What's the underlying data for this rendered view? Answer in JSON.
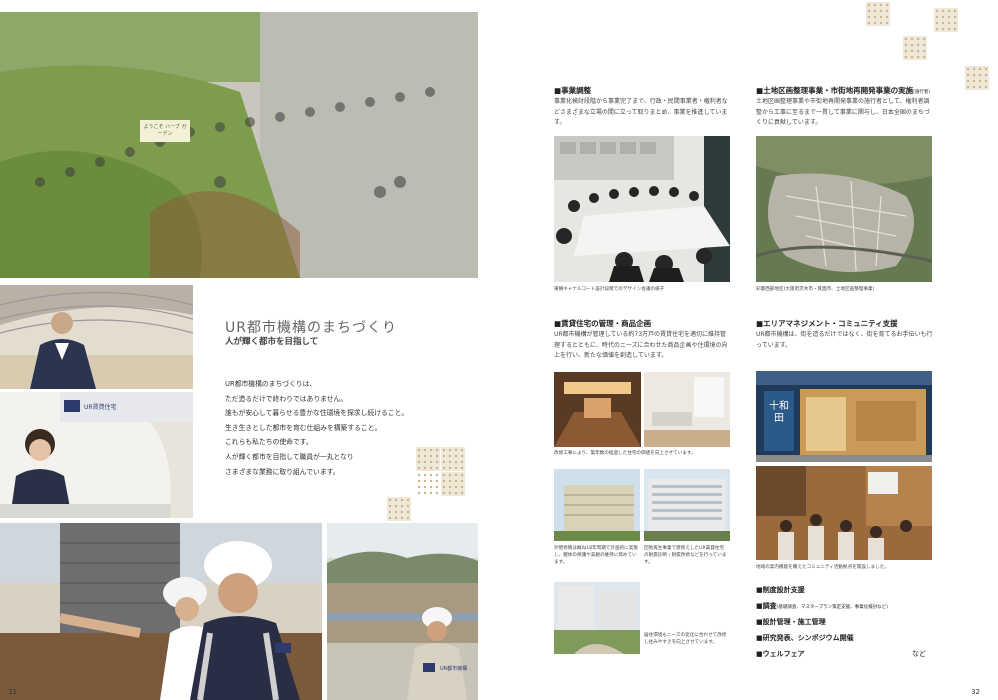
{
  "left_page": {
    "page_number": "31",
    "main_title": "UR都市機構のまちづくり",
    "subtitle": "人が輝く都市を目指して",
    "intro_lines": [
      "UR都市機構のまちづくりは、",
      "ただ造るだけで終わりではありません。",
      "誰もが安心して暮らせる豊かな住環境を探求し続けること。",
      "生き生きとした都市を育む仕組みを構築すること。",
      "これらも私たちの使命です。",
      "人が輝く都市を目指して職員が一丸となり",
      "さまざまな業務に取り組んでいます。"
    ],
    "banner_sign": "ようこそ ハーブ ガーデン",
    "counter_sign": "UR賃貸住宅",
    "helmet_logo": "UR都市機構"
  },
  "right_page": {
    "page_number": "32",
    "sections": {
      "coordination": {
        "title": "■事業調整",
        "body": "事業化検討段階から事業完了まで、行政・民間事業者・権利者などさまざまな立場の間に立って取りまとめ、事業を推進しています。",
        "caption": "東横キャナルコート設計段階でのデザイン会議の様子"
      },
      "land_readjustment": {
        "title": "■土地区画整理事業・市街地再開発事業の実施",
        "title_note": "(施行者)",
        "body": "土地区画整理事業や市街地再開発事業の施行者として、権利者調整から工事に至るまで一貫して事業に関与し、日本全国のまちづくりに貢献しています。",
        "caption": "彩都西部地区(大阪府茨木市・箕面市、土地区画整理事業)"
      },
      "rental_housing": {
        "title": "■賃貸住宅の管理・商品企画",
        "body": "UR都市機構が管理している約73万戸の賃貸住宅を適切に維持管理するとともに、時代のニーズに合わせた商品企画や住環境の向上を行い、新たな価値を創造しています。",
        "caption_interior": "改修工事により、築年数の経過した住宅の価値を向上させています。",
        "caption_maintenance": "外壁修繕は概ね18年周期で計画的に実施し、躯体の保護や美観の維持に努めています。",
        "caption_renewal": "団地再生事業で建替えしたUR賃貸住宅の耐震診断・耐震改修などを行っています。",
        "caption_needs": "居住環境もニーズの変化に合わせて改修し住みやすさを向上させています。"
      },
      "area_management": {
        "title": "■エリアマネジメント・コミュニティ支援",
        "body": "UR都市機構は、街を造るだけではなく、街を育てるお手伝いも行っています。",
        "caption": "地域の案内機能を備えたコミュニティ活動拠点を開設しました。",
        "shop_sign": "十和田"
      }
    },
    "list": [
      {
        "label": "■制度設計支援",
        "note": ""
      },
      {
        "label": "■調査",
        "note": "(基礎調査、マスタープラン策定支援、事業化検討など)"
      },
      {
        "label": "■設計管理・施工管理",
        "note": ""
      },
      {
        "label": "■研究発表、シンポジウム開催",
        "note": ""
      },
      {
        "label": "■ウェルフェア",
        "note": ""
      }
    ],
    "list_suffix": "など"
  },
  "colors": {
    "title_gray": "#666666",
    "accent_navy": "#2d3a6b",
    "pattern_beige": "#efe7d7"
  }
}
